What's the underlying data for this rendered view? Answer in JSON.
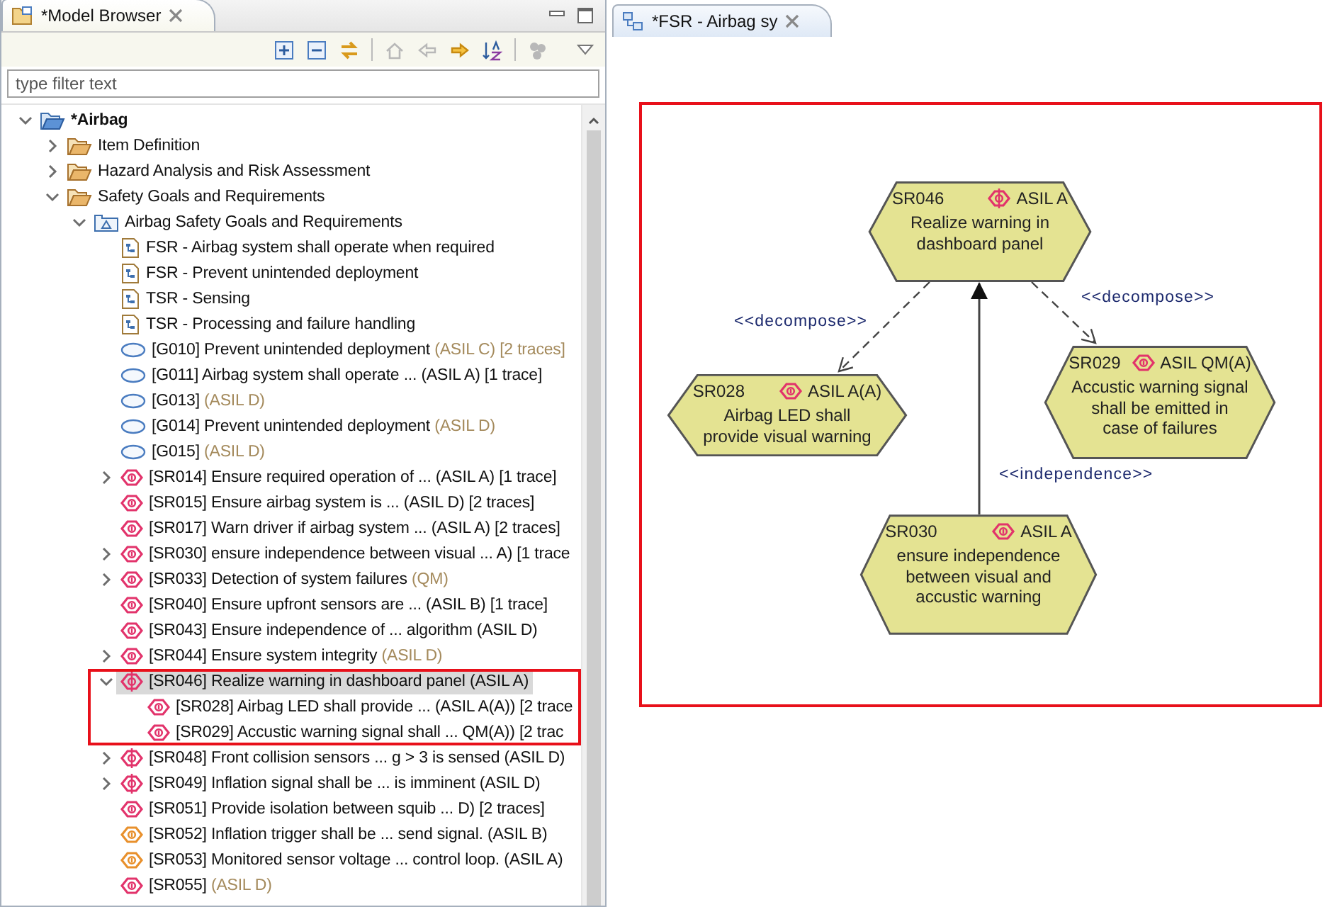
{
  "model_browser": {
    "tab": {
      "title": "*Model Browser"
    },
    "toolbar": [
      {
        "kind": "expand-all",
        "disabled": false
      },
      {
        "kind": "collapse-all",
        "disabled": false
      },
      {
        "kind": "link",
        "disabled": false
      },
      {
        "kind": "home",
        "disabled": true
      },
      {
        "kind": "back",
        "disabled": true
      },
      {
        "kind": "forward",
        "disabled": false
      },
      {
        "kind": "sort",
        "disabled": false
      },
      {
        "kind": "filter",
        "disabled": true
      }
    ],
    "filter": {
      "placeholder": "type filter text"
    },
    "tree": [
      {
        "label": "*Airbag",
        "kind": "project",
        "expanded": true,
        "selected": false,
        "children": [
          {
            "label": "Item Definition",
            "kind": "folder",
            "expanded": false,
            "selected": false
          },
          {
            "label": "Hazard Analysis and Risk Assessment",
            "kind": "folder",
            "expanded": false,
            "selected": false
          },
          {
            "label": "Safety Goals and Requirements",
            "kind": "folder",
            "expanded": true,
            "selected": false,
            "children": [
              {
                "label": "Airbag Safety Goals and Requirements",
                "kind": "package",
                "expanded": true,
                "selected": false,
                "children": [
                  {
                    "label": "FSR - Airbag system shall operate when required",
                    "kind": "diagram",
                    "selected": false
                  },
                  {
                    "label": "FSR - Prevent unintended deployment",
                    "kind": "diagram",
                    "selected": false
                  },
                  {
                    "label": "TSR - Sensing",
                    "kind": "diagram",
                    "selected": false
                  },
                  {
                    "label": "TSR - Processing and failure handling",
                    "kind": "diagram",
                    "selected": false
                  },
                  {
                    "label": "[G010] Prevent unintended deployment",
                    "suffix": "(ASIL C) [2 traces]",
                    "kind": "goal",
                    "selected": false
                  },
                  {
                    "label": "[G011] Airbag system shall operate ... (ASIL A) [1 trace]",
                    "kind": "goal",
                    "selected": false
                  },
                  {
                    "label": "[G013]",
                    "suffix": "(ASIL D)",
                    "kind": "goal",
                    "selected": false
                  },
                  {
                    "label": "[G014] Prevent unintended deployment",
                    "suffix": "(ASIL D)",
                    "kind": "goal",
                    "selected": false
                  },
                  {
                    "label": "[G015]",
                    "suffix": "(ASIL D)",
                    "kind": "goal",
                    "selected": false
                  },
                  {
                    "label": "[SR014] Ensure required operation of ... (ASIL A) [1 trace]",
                    "kind": "requirement",
                    "expanded": false,
                    "selected": false
                  },
                  {
                    "label": "[SR015] Ensure airbag system is ... (ASIL D) [2 traces]",
                    "kind": "requirement",
                    "selected": false
                  },
                  {
                    "label": "[SR017] Warn driver if airbag system ... (ASIL A) [2 traces]",
                    "kind": "requirement",
                    "selected": false
                  },
                  {
                    "label": "[SR030] ensure independence between visual ... A) [1 trace",
                    "kind": "requirement",
                    "expanded": false,
                    "selected": false
                  },
                  {
                    "label": "[SR033] Detection of system failures",
                    "suffix": "(QM)",
                    "kind": "requirement",
                    "expanded": false,
                    "selected": false
                  },
                  {
                    "label": "[SR040] Ensure upfront sensors are ... (ASIL B) [1 trace]",
                    "kind": "requirement",
                    "selected": false
                  },
                  {
                    "label": "[SR043] Ensure independence of ... algorithm (ASIL D)",
                    "kind": "requirement",
                    "selected": false
                  },
                  {
                    "label": "[SR044] Ensure system integrity",
                    "suffix": "(ASIL D)",
                    "kind": "requirement",
                    "expanded": false,
                    "selected": false
                  },
                  {
                    "label": "[SR046] Realize warning in dashboard panel (ASIL A)",
                    "kind": "decomposed",
                    "expanded": true,
                    "selected": true,
                    "highlighted": true,
                    "children": [
                      {
                        "label": "[SR028] Airbag LED shall provide ... (ASIL A(A)) [2 trace",
                        "kind": "requirement",
                        "selected": false
                      },
                      {
                        "label": "[SR029] Accustic warning signal shall ... QM(A)) [2 trac",
                        "kind": "requirement",
                        "selected": false
                      }
                    ]
                  },
                  {
                    "label": "[SR048] Front collision sensors ... g > 3 is sensed (ASIL D)",
                    "kind": "decomposed",
                    "expanded": false,
                    "selected": false
                  },
                  {
                    "label": "[SR049] Inflation signal shall be ... is imminent (ASIL D)",
                    "kind": "decomposed",
                    "expanded": false,
                    "selected": false
                  },
                  {
                    "label": "[SR051] Provide isolation between squib ... D) [2 traces]",
                    "kind": "requirement",
                    "selected": false
                  },
                  {
                    "label": "[SR052] Inflation trigger shall be ... send signal. (ASIL B)",
                    "kind": "safety",
                    "selected": false
                  },
                  {
                    "label": "[SR053] Monitored sensor voltage ... control loop. (ASIL A)",
                    "kind": "safety",
                    "selected": false
                  },
                  {
                    "label": "[SR055]",
                    "suffix": "(ASIL D)",
                    "kind": "requirement",
                    "selected": false
                  }
                ]
              }
            ]
          }
        ]
      }
    ]
  },
  "diagram_editor": {
    "tab": {
      "title": "*FSR - Airbag sy"
    },
    "nodes": [
      {
        "id": "SR046",
        "kind": "decomposed",
        "asil": "ASIL A",
        "text": "Realize warning in dashboard panel"
      },
      {
        "id": "SR028",
        "kind": "requirement",
        "asil": "ASIL A(A)",
        "text": "Airbag LED shall provide visual warning"
      },
      {
        "id": "SR029",
        "kind": "requirement",
        "asil": "ASIL QM(A)",
        "text": "Accustic warning signal shall be emitted in case of failures"
      },
      {
        "id": "SR030",
        "kind": "requirement",
        "asil": "ASIL A",
        "text": "ensure independence between visual and accustic warning"
      }
    ],
    "edges": [
      {
        "kind": "dashed",
        "label": "<<decompose>>"
      },
      {
        "kind": "dashed",
        "label": "<<decompose>>"
      },
      {
        "kind": "solid",
        "label": "<<independence>>"
      }
    ]
  }
}
